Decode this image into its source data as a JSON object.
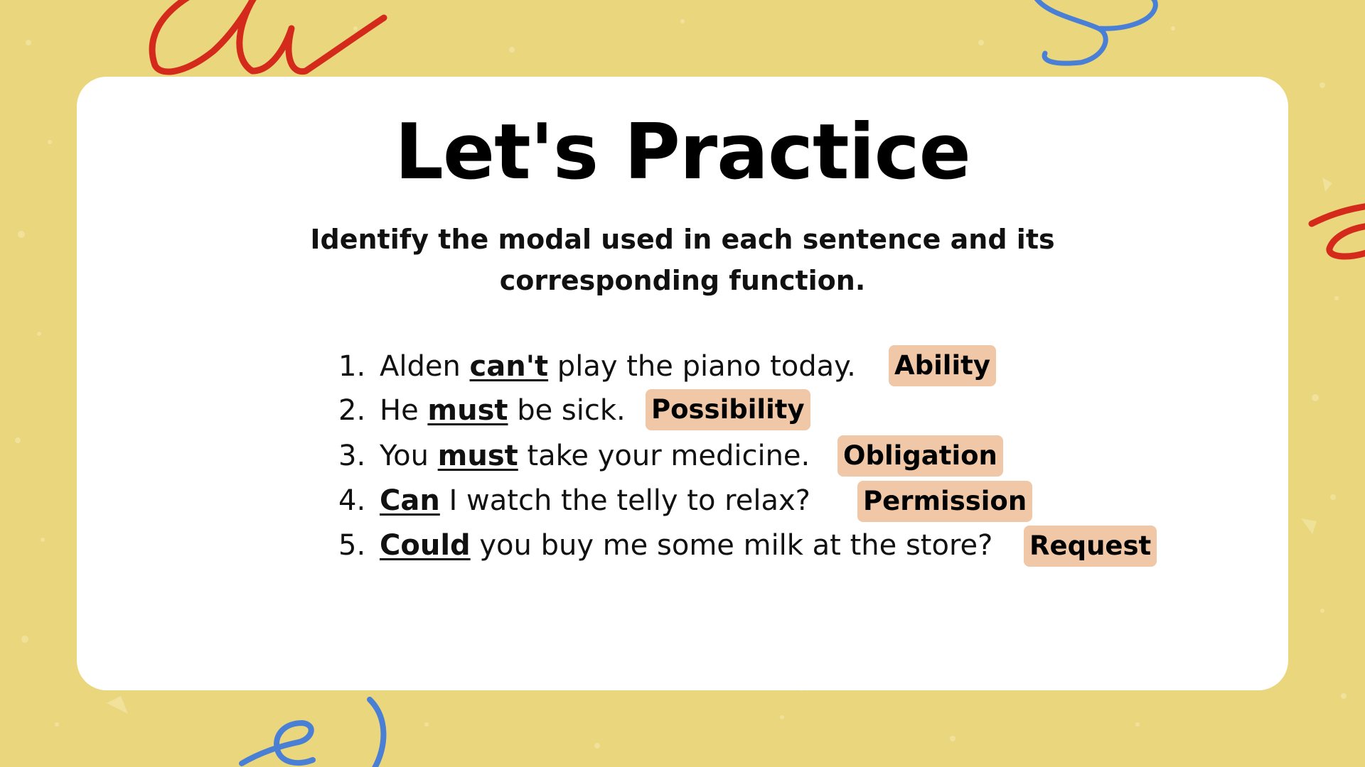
{
  "slide": {
    "title": "Let's Practice",
    "instruction": {
      "line1": "Identify the modal used in each sentence and its",
      "line2": "corresponding function."
    },
    "items": [
      {
        "number": "1.",
        "before": "Alden ",
        "modal": "can't",
        "after": " play the piano today.",
        "function": "Ability"
      },
      {
        "number": "2.",
        "before": "He ",
        "modal": "must",
        "after": " be sick.",
        "function": "Possibility"
      },
      {
        "number": "3.",
        "before": "You ",
        "modal": "must",
        "after": " take your medicine.",
        "function": "Obligation"
      },
      {
        "number": "4.",
        "before": "",
        "modal": "Can",
        "after": " I watch the telly to relax?",
        "function": "Permission"
      },
      {
        "number": "5.",
        "before": "",
        "modal": "Could",
        "after": " you buy me some milk at the store?",
        "function": "Request"
      }
    ]
  },
  "colors": {
    "background": "#e9d67d",
    "card": "#ffffff",
    "function_tag": "#f0c7a7",
    "doodle_red": "#d42a1b",
    "doodle_blue": "#4a7fd6"
  }
}
